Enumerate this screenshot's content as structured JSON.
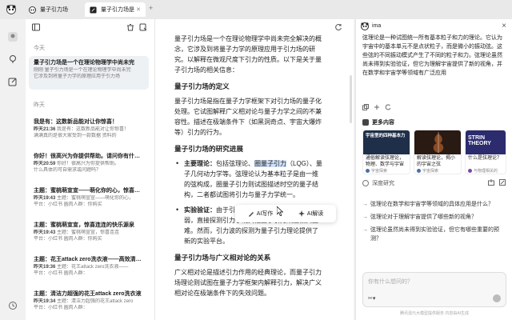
{
  "tabs": [
    {
      "label": "量子引力场"
    },
    {
      "label": "量子引力场是"
    }
  ],
  "sidebar": {
    "today_label": "今天",
    "yesterday_label": "昨天",
    "selected": {
      "title": "量子引力场是一个在理论物理学中尚未完",
      "sub1": "刚刚 量子引力场是一个在理论物理学中尚未完",
      "sub2": "它涉及到将量子力学的原理应用于引力场"
    },
    "items": [
      {
        "title": "我是有：这数新品能对让你惊喜！",
        "meta": "昨天21:36",
        "sub1": "我是有：这数新品能对让你惊喜！",
        "sub2": "满满真的是很大家受到一款数据 资料的"
      },
      {
        "title": "你好！很高兴为你提供帮助。请问你有什…",
        "meta": "昨天20:59",
        "sub1": "你好！很高兴为你提供帮助。",
        "sub2": "什么具体的可自需求或问题吗？"
      },
      {
        "title": "主题：蜜桃萌宣宣——萌化你的心，惊喜连…",
        "meta": "昨天19:43",
        "sub1": "主题：蜜桃萌宣宣——萌化你的心，",
        "sub2": "平台：小红书  圆肉人群：你购买"
      },
      {
        "title": "主题：蜜桃萌宣宣，惊喜连连的快乐源泉",
        "meta": "昨天19:43",
        "sub1": "主题：蜜桃萌宣宣，惊喜连连",
        "sub2": "平台：小红书  圆肉人群：你购买"
      },
      {
        "title": "主题：花王attack zero洗衣液——高效清…",
        "meta": "昨天19:36",
        "sub1": "主题：花王attack zero洗衣液——",
        "sub2": "平台：小红书  圆肉人群："
      },
      {
        "title": "主题：清洁力超强的花王attack zero洗衣液",
        "meta": "昨天19:34",
        "sub1": "主题：清洁力超强的花王attack zero",
        "sub2": "平台：小红书  圆肉人群："
      }
    ]
  },
  "doc": {
    "intro": "量子引力场是一个在理论物理学中尚未完全解决的概念，它涉及到将量子力学的原理应用于引力场的研究。以解释在微观尺度下引力的性质。以下是关于量子引力场的相关信息：",
    "h1": "量子引力场的定义",
    "p1": "量子引力场是指在量子力学框架下对引力场的量子化处理。它试图解释广义相对论与量子力学之间的不兼容性。描述在极端条件下（如黑洞奇点、宇宙大爆炸等）引力的行为。",
    "h2": "量子引力场的研究进展",
    "li1_label": "主要理论：",
    "li1_pre": "包括弦理论、",
    "li1_hl": "圈量子引力",
    "li1_post": "（LQG）、量子几何动力学等。弦理论认为基本粒子是由一维的弦构成，圈量子引力则试图描述时空的量子结构，二者都试图将引力与量子力学统一。",
    "li2_label": "实验验证：",
    "li2_text": "由于引力在微观尺度下的作用极其微弱，直接探测引力子或其他量子引力效应极其困难。然而，引力波的探测为量子引力理论提供了新的实验平台。",
    "h3": "量子引力场与广义相对论的关系",
    "p3": "广义相对论是描述引力作用的经典理论，而量子引力场理论则试图在量子力学框架内解释引力，解决广义相对论在极端条件下的失效问题。"
  },
  "popup": {
    "write": "AI写作",
    "explain": "AI解读"
  },
  "rpanel": {
    "name": "ima",
    "answer": "弦理论是一种试图统一所有基本粒子和力的理论。它认为宇宙中的基本单元不是点状粒子，而是微小的振动弦。这些弦的不同振动模式产生了不同的粒子和力。弦理论虽然尚未得到实验验证，但它为理解宇宙提供了新的视角，并在数学和宇宙学等领域有广泛应用",
    "more_title": "更多内容",
    "cards": [
      {
        "thumb_title": "宇宙里的四种基本力",
        "title": "通俗解读弦理论，物理、数学与宇宙",
        "source": "宇宙探索",
        "color": "#1f2f4a"
      },
      {
        "thumb_title": "",
        "title": "解读弦理论，揭小的宇宙之弦",
        "source": "宇宙探索",
        "color": "#2a1a14"
      },
      {
        "thumb_title": "STRIN THEORY",
        "title": "什么是弦理论？",
        "source": "与物理相关的",
        "color": "#2b2b6e"
      }
    ],
    "deep_label": "深度研究",
    "suggestions": [
      "弦理论在数学和宇宙学等领域的具体应用是什么？",
      "弦理论对于理解宇宙提供了哪些新的视角？",
      "弦理论虽然尚未得到实验验证，但它有哪些重要的预测？"
    ],
    "input_placeholder": "你有什么想问的？",
    "disclaimer": "腾讯混元大模型提供服务 内容由AI生成"
  },
  "colors": {
    "highlight": "#cfe0f7",
    "selected_bg": "#eef1f3"
  }
}
